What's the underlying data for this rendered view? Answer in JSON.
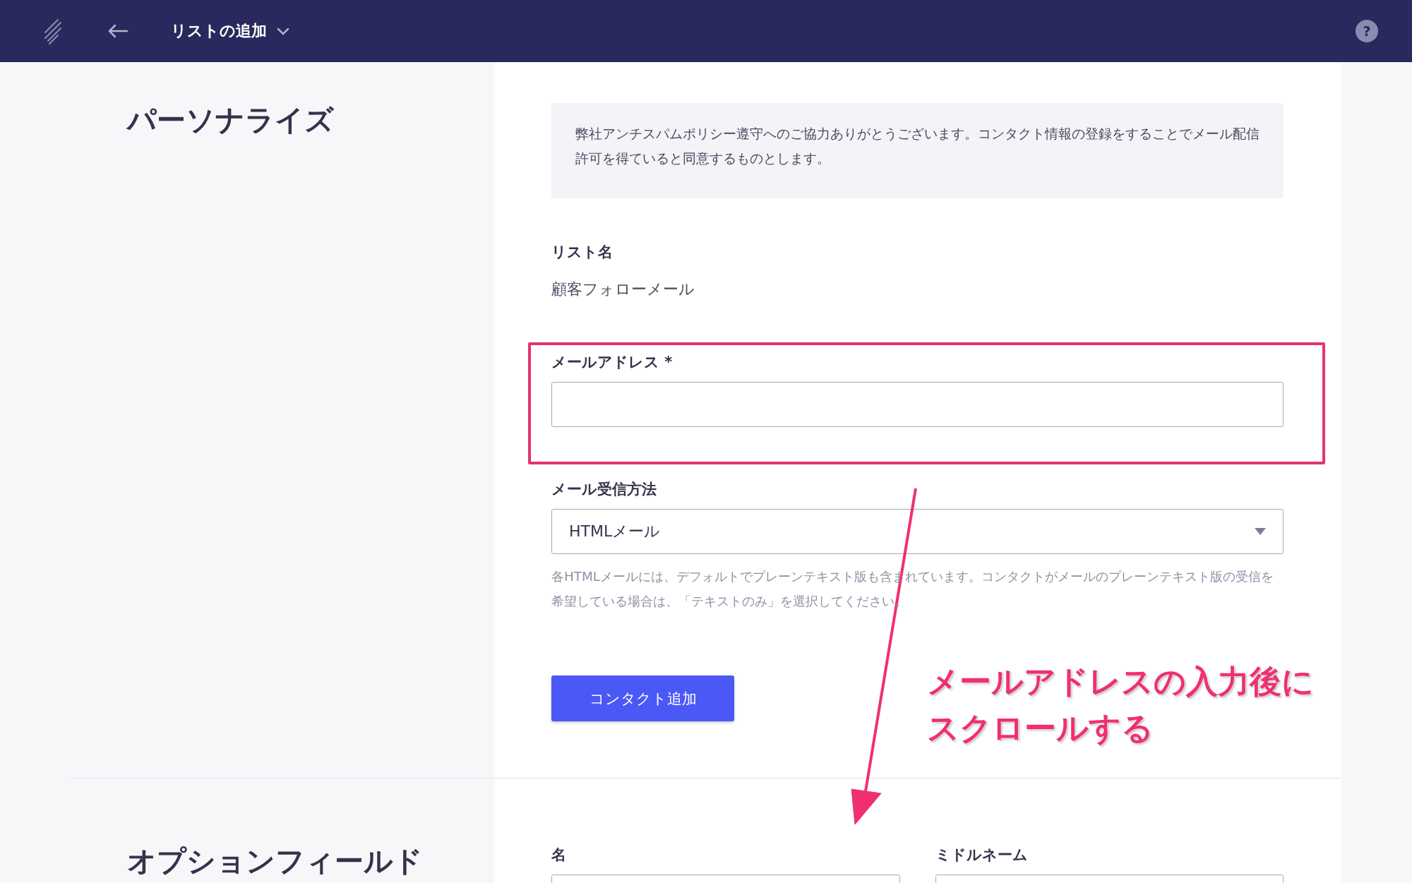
{
  "header": {
    "title": "リストの追加",
    "help_icon": "?"
  },
  "personalize": {
    "title": "パーソナライズ",
    "notice": "弊社アンチスパムポリシー遵守へのご協力ありがとうございます。コンタクト情報の登録をすることでメール配信許可を得ていると同意するものとします。",
    "list_name": {
      "label": "リスト名",
      "value": "顧客フォローメール"
    },
    "fields": [
      {
        "kind": "text",
        "label": "メールアドレス *",
        "highlighted": true
      },
      {
        "kind": "select",
        "label": "メール受信方法",
        "value": "HTMLメール",
        "help": "各HTMLメールには、デフォルトでプレーンテキスト版も含まれています。コンタクトがメールのプレーンテキスト版の受信を希望している場合は、「テキストのみ」を選択してください。",
        "highlighted": false
      }
    ],
    "button": "コンタクト追加"
  },
  "optional_fields": {
    "title": "オプションフィールド",
    "fields": [
      {
        "kind": "text",
        "label": "名",
        "highlighted": false
      },
      {
        "kind": "text",
        "label": "ミドルネーム",
        "highlighted": false
      }
    ]
  },
  "annotation": {
    "lines": [
      "メールアドレスの入力後に",
      "スクロールする"
    ]
  }
}
